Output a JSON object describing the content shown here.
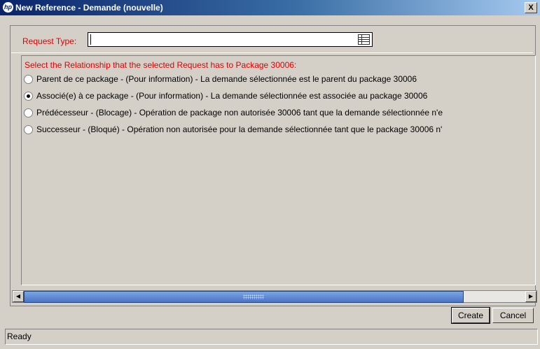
{
  "window": {
    "title": "New Reference - Demande (nouvelle)",
    "close_label": "X",
    "logo_text": "hp"
  },
  "request_type": {
    "label": "Request Type:",
    "value": ""
  },
  "relationship": {
    "heading": "Select the Relationship that the selected Request has to Package 30006:",
    "selected_index": 1,
    "options": [
      {
        "label": "Parent de ce package - (Pour information) - La demande sélectionnée est le parent du package 30006",
        "checked": false
      },
      {
        "label": "Associé(e) à ce package - (Pour information) - La demande sélectionnée est associée au package 30006",
        "checked": true
      },
      {
        "label": "Prédécesseur - (Blocage) - Opération de package non autorisée 30006 tant que la demande sélectionnée n'e",
        "checked": false
      },
      {
        "label": "Successeur - (Bloqué) - Opération non autorisée pour la demande sélectionnée tant que le package 30006 n'",
        "checked": false
      }
    ]
  },
  "buttons": {
    "create": "Create",
    "cancel": "Cancel"
  },
  "status": "Ready",
  "icons": {
    "lookup": "table-lookup-icon",
    "scroll_left": "arrow-left-icon",
    "scroll_right": "arrow-right-icon"
  }
}
